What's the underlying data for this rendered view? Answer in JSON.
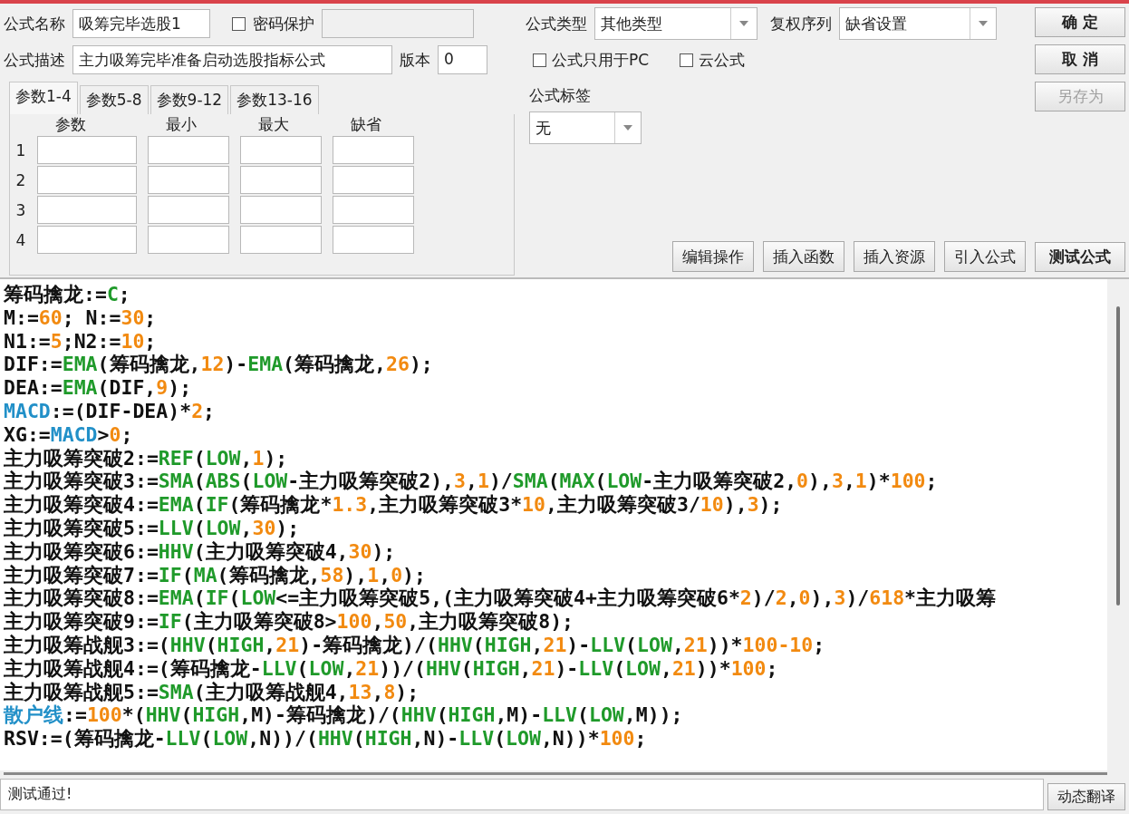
{
  "formula_name": {
    "label": "公式名称",
    "value": "吸筹完毕选股1"
  },
  "password_protect": {
    "label": "密码保护",
    "checked": false
  },
  "password_field": {
    "disabled": true
  },
  "formula_desc": {
    "label": "公式描述",
    "value": "主力吸筹完毕准备启动选股指标公式"
  },
  "version": {
    "label": "版本",
    "value": "0"
  },
  "formula_type": {
    "label": "公式类型",
    "value": "其他类型"
  },
  "adjust_series": {
    "label": "复权序列",
    "value": "缺省设置"
  },
  "options": [
    {
      "label": "公式只用于PC",
      "checked": false
    },
    {
      "label": "云公式",
      "checked": false
    }
  ],
  "formula_tag": {
    "label": "公式标签",
    "value": "无"
  },
  "side_buttons": [
    {
      "label": "确  定",
      "disabled": false
    },
    {
      "label": "取  消",
      "disabled": false
    },
    {
      "label": "另存为",
      "disabled": true
    }
  ],
  "tabs": [
    {
      "label": "参数1-4",
      "selected": true
    },
    {
      "label": "参数5-8",
      "selected": false
    },
    {
      "label": "参数9-12",
      "selected": false
    },
    {
      "label": "参数13-16",
      "selected": false
    }
  ],
  "param_columns": [
    "参数",
    "最小",
    "最大",
    "缺省"
  ],
  "param_rows": [
    "1",
    "2",
    "3",
    "4"
  ],
  "tool_buttons": [
    "编辑操作",
    "插入函数",
    "插入资源",
    "引入公式",
    "测试公式"
  ],
  "code_lines": [
    [
      {
        "kind": "plain",
        "text": "筹码擒龙:="
      },
      {
        "kind": "func",
        "text": "C"
      },
      {
        "kind": "plain",
        "text": ";"
      }
    ],
    [
      {
        "kind": "plain",
        "text": "M:="
      },
      {
        "kind": "num",
        "text": "60"
      },
      {
        "kind": "plain",
        "text": "; N:="
      },
      {
        "kind": "num",
        "text": "30"
      },
      {
        "kind": "plain",
        "text": ";"
      }
    ],
    [
      {
        "kind": "plain",
        "text": "N1:="
      },
      {
        "kind": "num",
        "text": "5"
      },
      {
        "kind": "plain",
        "text": ";N2:="
      },
      {
        "kind": "num",
        "text": "10"
      },
      {
        "kind": "plain",
        "text": ";"
      }
    ],
    [
      {
        "kind": "plain",
        "text": "DIF:="
      },
      {
        "kind": "func",
        "text": "EMA"
      },
      {
        "kind": "plain",
        "text": "(筹码擒龙,"
      },
      {
        "kind": "num",
        "text": "12"
      },
      {
        "kind": "plain",
        "text": ")-"
      },
      {
        "kind": "func",
        "text": "EMA"
      },
      {
        "kind": "plain",
        "text": "(筹码擒龙,"
      },
      {
        "kind": "num",
        "text": "26"
      },
      {
        "kind": "plain",
        "text": ");"
      }
    ],
    [
      {
        "kind": "plain",
        "text": "DEA:="
      },
      {
        "kind": "func",
        "text": "EMA"
      },
      {
        "kind": "plain",
        "text": "(DIF,"
      },
      {
        "kind": "num",
        "text": "9"
      },
      {
        "kind": "plain",
        "text": ");"
      }
    ],
    [
      {
        "kind": "var",
        "text": "MACD"
      },
      {
        "kind": "plain",
        "text": ":=(DIF-DEA)*"
      },
      {
        "kind": "num",
        "text": "2"
      },
      {
        "kind": "plain",
        "text": ";"
      }
    ],
    [
      {
        "kind": "plain",
        "text": "XG:="
      },
      {
        "kind": "var",
        "text": "MACD"
      },
      {
        "kind": "plain",
        "text": ">"
      },
      {
        "kind": "num",
        "text": "0"
      },
      {
        "kind": "plain",
        "text": ";"
      }
    ],
    [
      {
        "kind": "plain",
        "text": "主力吸筹突破2:="
      },
      {
        "kind": "func",
        "text": "REF"
      },
      {
        "kind": "plain",
        "text": "("
      },
      {
        "kind": "func",
        "text": "LOW"
      },
      {
        "kind": "plain",
        "text": ","
      },
      {
        "kind": "num",
        "text": "1"
      },
      {
        "kind": "plain",
        "text": ");"
      }
    ],
    [
      {
        "kind": "plain",
        "text": "主力吸筹突破3:="
      },
      {
        "kind": "func",
        "text": "SMA"
      },
      {
        "kind": "plain",
        "text": "("
      },
      {
        "kind": "func",
        "text": "ABS"
      },
      {
        "kind": "plain",
        "text": "("
      },
      {
        "kind": "func",
        "text": "LOW"
      },
      {
        "kind": "plain",
        "text": "-主力吸筹突破2),"
      },
      {
        "kind": "num",
        "text": "3"
      },
      {
        "kind": "plain",
        "text": ","
      },
      {
        "kind": "num",
        "text": "1"
      },
      {
        "kind": "plain",
        "text": ")/"
      },
      {
        "kind": "func",
        "text": "SMA"
      },
      {
        "kind": "plain",
        "text": "("
      },
      {
        "kind": "func",
        "text": "MAX"
      },
      {
        "kind": "plain",
        "text": "("
      },
      {
        "kind": "func",
        "text": "LOW"
      },
      {
        "kind": "plain",
        "text": "-主力吸筹突破2,"
      },
      {
        "kind": "num",
        "text": "0"
      },
      {
        "kind": "plain",
        "text": "),"
      },
      {
        "kind": "num",
        "text": "3"
      },
      {
        "kind": "plain",
        "text": ","
      },
      {
        "kind": "num",
        "text": "1"
      },
      {
        "kind": "plain",
        "text": ")*"
      },
      {
        "kind": "num",
        "text": "100"
      },
      {
        "kind": "plain",
        "text": ";"
      }
    ],
    [
      {
        "kind": "plain",
        "text": "主力吸筹突破4:="
      },
      {
        "kind": "func",
        "text": "EMA"
      },
      {
        "kind": "plain",
        "text": "("
      },
      {
        "kind": "func",
        "text": "IF"
      },
      {
        "kind": "plain",
        "text": "(筹码擒龙*"
      },
      {
        "kind": "num",
        "text": "1.3"
      },
      {
        "kind": "plain",
        "text": ",主力吸筹突破3*"
      },
      {
        "kind": "num",
        "text": "10"
      },
      {
        "kind": "plain",
        "text": ",主力吸筹突破3/"
      },
      {
        "kind": "num",
        "text": "10"
      },
      {
        "kind": "plain",
        "text": "),"
      },
      {
        "kind": "num",
        "text": "3"
      },
      {
        "kind": "plain",
        "text": ");"
      }
    ],
    [
      {
        "kind": "plain",
        "text": "主力吸筹突破5:="
      },
      {
        "kind": "func",
        "text": "LLV"
      },
      {
        "kind": "plain",
        "text": "("
      },
      {
        "kind": "func",
        "text": "LOW"
      },
      {
        "kind": "plain",
        "text": ","
      },
      {
        "kind": "num",
        "text": "30"
      },
      {
        "kind": "plain",
        "text": ");"
      }
    ],
    [
      {
        "kind": "plain",
        "text": "主力吸筹突破6:="
      },
      {
        "kind": "func",
        "text": "HHV"
      },
      {
        "kind": "plain",
        "text": "(主力吸筹突破4,"
      },
      {
        "kind": "num",
        "text": "30"
      },
      {
        "kind": "plain",
        "text": ");"
      }
    ],
    [
      {
        "kind": "plain",
        "text": "主力吸筹突破7:="
      },
      {
        "kind": "func",
        "text": "IF"
      },
      {
        "kind": "plain",
        "text": "("
      },
      {
        "kind": "func",
        "text": "MA"
      },
      {
        "kind": "plain",
        "text": "(筹码擒龙,"
      },
      {
        "kind": "num",
        "text": "58"
      },
      {
        "kind": "plain",
        "text": "),"
      },
      {
        "kind": "num",
        "text": "1"
      },
      {
        "kind": "plain",
        "text": ","
      },
      {
        "kind": "num",
        "text": "0"
      },
      {
        "kind": "plain",
        "text": ");"
      }
    ],
    [
      {
        "kind": "plain",
        "text": "主力吸筹突破8:="
      },
      {
        "kind": "func",
        "text": "EMA"
      },
      {
        "kind": "plain",
        "text": "("
      },
      {
        "kind": "func",
        "text": "IF"
      },
      {
        "kind": "plain",
        "text": "("
      },
      {
        "kind": "func",
        "text": "LOW"
      },
      {
        "kind": "plain",
        "text": "<=主力吸筹突破5,(主力吸筹突破4+主力吸筹突破6*"
      },
      {
        "kind": "num",
        "text": "2"
      },
      {
        "kind": "plain",
        "text": ")/"
      },
      {
        "kind": "num",
        "text": "2"
      },
      {
        "kind": "plain",
        "text": ","
      },
      {
        "kind": "num",
        "text": "0"
      },
      {
        "kind": "plain",
        "text": "),"
      },
      {
        "kind": "num",
        "text": "3"
      },
      {
        "kind": "plain",
        "text": ")/"
      },
      {
        "kind": "num",
        "text": "618"
      },
      {
        "kind": "plain",
        "text": "*主力吸筹"
      }
    ],
    [
      {
        "kind": "plain",
        "text": "主力吸筹突破9:="
      },
      {
        "kind": "func",
        "text": "IF"
      },
      {
        "kind": "plain",
        "text": "(主力吸筹突破8>"
      },
      {
        "kind": "num",
        "text": "100"
      },
      {
        "kind": "plain",
        "text": ","
      },
      {
        "kind": "num",
        "text": "50"
      },
      {
        "kind": "plain",
        "text": ",主力吸筹突破8);"
      }
    ],
    [
      {
        "kind": "plain",
        "text": "主力吸筹战舰3:=("
      },
      {
        "kind": "func",
        "text": "HHV"
      },
      {
        "kind": "plain",
        "text": "("
      },
      {
        "kind": "func",
        "text": "HIGH"
      },
      {
        "kind": "plain",
        "text": ","
      },
      {
        "kind": "num",
        "text": "21"
      },
      {
        "kind": "plain",
        "text": ")-筹码擒龙)/("
      },
      {
        "kind": "func",
        "text": "HHV"
      },
      {
        "kind": "plain",
        "text": "("
      },
      {
        "kind": "func",
        "text": "HIGH"
      },
      {
        "kind": "plain",
        "text": ","
      },
      {
        "kind": "num",
        "text": "21"
      },
      {
        "kind": "plain",
        "text": ")-"
      },
      {
        "kind": "func",
        "text": "LLV"
      },
      {
        "kind": "plain",
        "text": "("
      },
      {
        "kind": "func",
        "text": "LOW"
      },
      {
        "kind": "plain",
        "text": ","
      },
      {
        "kind": "num",
        "text": "21"
      },
      {
        "kind": "plain",
        "text": "))*"
      },
      {
        "kind": "num",
        "text": "100-10"
      },
      {
        "kind": "plain",
        "text": ";"
      }
    ],
    [
      {
        "kind": "plain",
        "text": "主力吸筹战舰4:=(筹码擒龙-"
      },
      {
        "kind": "func",
        "text": "LLV"
      },
      {
        "kind": "plain",
        "text": "("
      },
      {
        "kind": "func",
        "text": "LOW"
      },
      {
        "kind": "plain",
        "text": ","
      },
      {
        "kind": "num",
        "text": "21"
      },
      {
        "kind": "plain",
        "text": "))/("
      },
      {
        "kind": "func",
        "text": "HHV"
      },
      {
        "kind": "plain",
        "text": "("
      },
      {
        "kind": "func",
        "text": "HIGH"
      },
      {
        "kind": "plain",
        "text": ","
      },
      {
        "kind": "num",
        "text": "21"
      },
      {
        "kind": "plain",
        "text": ")-"
      },
      {
        "kind": "func",
        "text": "LLV"
      },
      {
        "kind": "plain",
        "text": "("
      },
      {
        "kind": "func",
        "text": "LOW"
      },
      {
        "kind": "plain",
        "text": ","
      },
      {
        "kind": "num",
        "text": "21"
      },
      {
        "kind": "plain",
        "text": "))*"
      },
      {
        "kind": "num",
        "text": "100"
      },
      {
        "kind": "plain",
        "text": ";"
      }
    ],
    [
      {
        "kind": "plain",
        "text": "主力吸筹战舰5:="
      },
      {
        "kind": "func",
        "text": "SMA"
      },
      {
        "kind": "plain",
        "text": "(主力吸筹战舰4,"
      },
      {
        "kind": "num",
        "text": "13"
      },
      {
        "kind": "plain",
        "text": ","
      },
      {
        "kind": "num",
        "text": "8"
      },
      {
        "kind": "plain",
        "text": ");"
      }
    ],
    [
      {
        "kind": "var",
        "text": "散户线"
      },
      {
        "kind": "plain",
        "text": ":="
      },
      {
        "kind": "num",
        "text": "100"
      },
      {
        "kind": "plain",
        "text": "*("
      },
      {
        "kind": "func",
        "text": "HHV"
      },
      {
        "kind": "plain",
        "text": "("
      },
      {
        "kind": "func",
        "text": "HIGH"
      },
      {
        "kind": "plain",
        "text": ",M)-筹码擒龙)/("
      },
      {
        "kind": "func",
        "text": "HHV"
      },
      {
        "kind": "plain",
        "text": "("
      },
      {
        "kind": "func",
        "text": "HIGH"
      },
      {
        "kind": "plain",
        "text": ",M)-"
      },
      {
        "kind": "func",
        "text": "LLV"
      },
      {
        "kind": "plain",
        "text": "("
      },
      {
        "kind": "func",
        "text": "LOW"
      },
      {
        "kind": "plain",
        "text": ",M));"
      }
    ],
    [
      {
        "kind": "plain",
        "text": "RSV:=(筹码擒龙-"
      },
      {
        "kind": "func",
        "text": "LLV"
      },
      {
        "kind": "plain",
        "text": "("
      },
      {
        "kind": "func",
        "text": "LOW"
      },
      {
        "kind": "plain",
        "text": ",N))/("
      },
      {
        "kind": "func",
        "text": "HHV"
      },
      {
        "kind": "plain",
        "text": "("
      },
      {
        "kind": "func",
        "text": "HIGH"
      },
      {
        "kind": "plain",
        "text": ",N)-"
      },
      {
        "kind": "func",
        "text": "LLV"
      },
      {
        "kind": "plain",
        "text": "("
      },
      {
        "kind": "func",
        "text": "LOW"
      },
      {
        "kind": "plain",
        "text": ",N))*"
      },
      {
        "kind": "num",
        "text": "100"
      },
      {
        "kind": "plain",
        "text": ";"
      }
    ]
  ],
  "status": {
    "message": "测试通过!",
    "button": "动态翻译"
  }
}
